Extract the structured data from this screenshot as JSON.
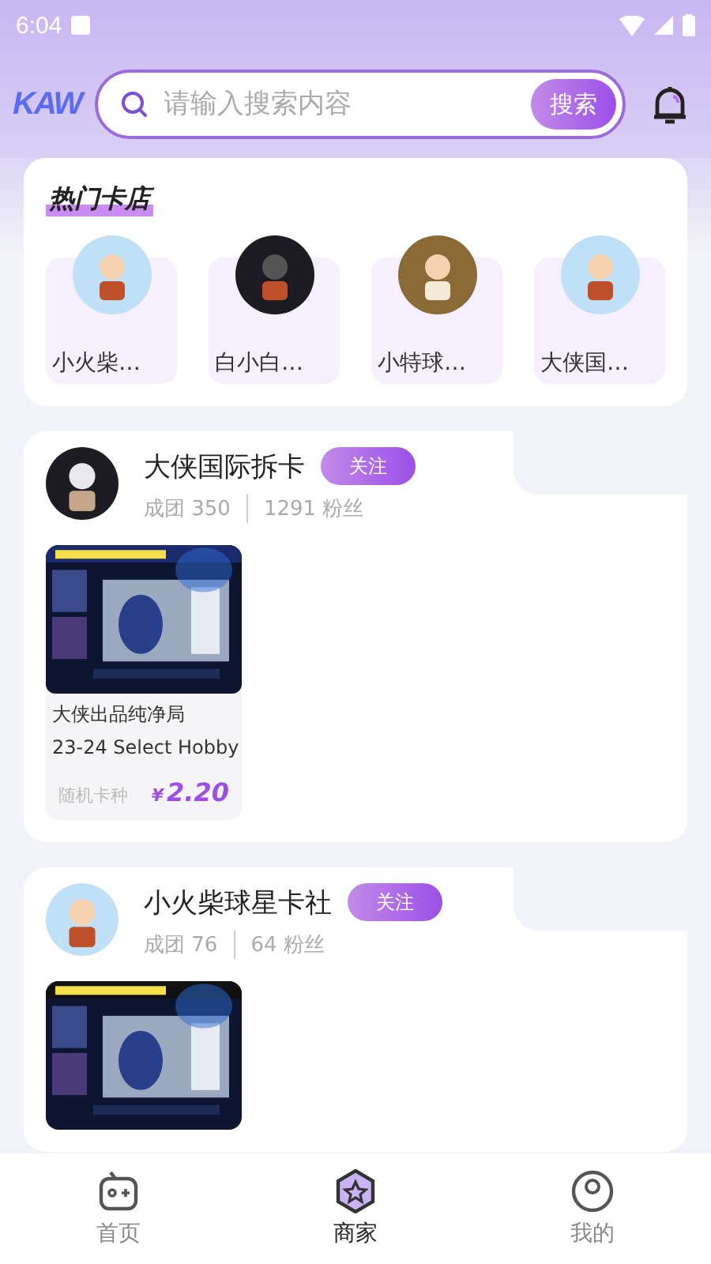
{
  "status_bar": {
    "time": "6:04"
  },
  "header": {
    "logo": "KAW",
    "search": {
      "placeholder": "请输入搜索内容"
    },
    "search_button": "搜索"
  },
  "hot_shops": {
    "title": "热门卡店",
    "items": [
      {
        "name": "小火柴…",
        "kind": "light"
      },
      {
        "name": "白小白…",
        "kind": "dark"
      },
      {
        "name": "小特球…",
        "kind": "brown"
      },
      {
        "name": "大侠国…",
        "kind": "light"
      }
    ]
  },
  "shops": [
    {
      "name": "大侠国际拆卡",
      "follow": "关注",
      "groups_label": "成团",
      "groups": "350",
      "fans": "1291",
      "fans_label": "粉丝",
      "kind": "dark",
      "products": [
        {
          "kind": "full",
          "title": "大侠出品纯净局",
          "subtitle": "23-24 Select Hobby",
          "tag": "随机卡种",
          "currency": "¥",
          "price": "2.20"
        }
      ]
    },
    {
      "name": "小火柴球星卡社",
      "follow": "关注",
      "groups_label": "成团",
      "groups": "76",
      "fans": "64",
      "fans_label": "粉丝",
      "kind": "light"
    }
  ],
  "nav": [
    {
      "label": "首页",
      "kind": "home",
      "selected": false
    },
    {
      "label": "商家",
      "kind": "shop",
      "selected": true
    },
    {
      "label": "我的",
      "kind": "me",
      "selected": false
    }
  ]
}
